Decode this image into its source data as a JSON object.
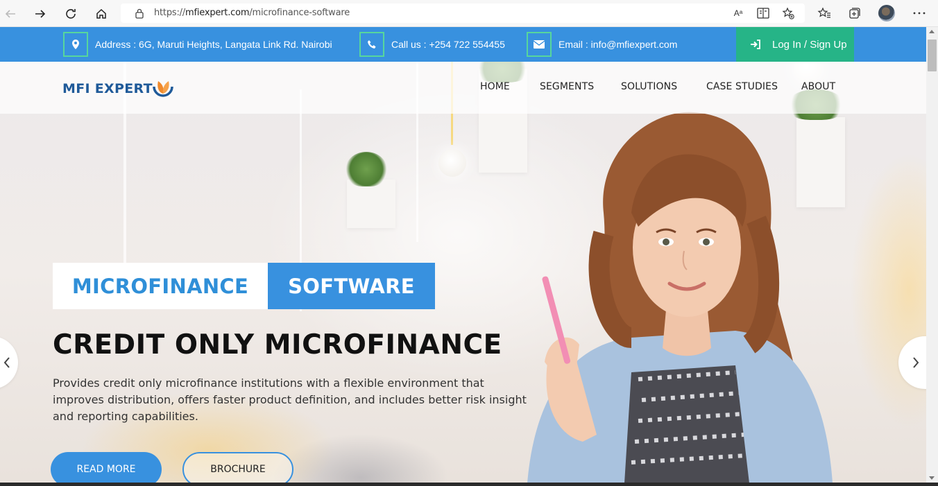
{
  "browser": {
    "url_prefix": "https://",
    "url_host": "mfiexpert.com",
    "url_path": "/microfinance-software",
    "read_aloud_icon": "Aᵃ"
  },
  "topbar": {
    "address": "Address : 6G, Maruti Heights, Langata Link Rd. Nairobi",
    "phone": "Call us : +254 722 554455",
    "email": "Email : info@mfiexpert.com",
    "login": "Log In / Sign Up"
  },
  "nav": {
    "logo": "MFI EXPERT",
    "items": [
      "HOME",
      "SEGMENTS",
      "SOLUTIONS",
      "CASE STUDIES",
      "ABOUT"
    ]
  },
  "hero": {
    "tag_white": "MICROFINANCE",
    "tag_blue": "SOFTWARE",
    "headline": "CREDIT ONLY MICROFINANCE",
    "description": "Provides credit only microfinance institutions with a flexible environment that improves distribution, offers faster product definition, and includes better risk insight and reporting capabilities.",
    "read_more": "READ MORE",
    "brochure": "BROCHURE"
  },
  "colors": {
    "primary_blue": "#3891df",
    "green": "#26b487",
    "logo_blue": "#1f5a99",
    "logo_orange": "#f08a2c"
  }
}
